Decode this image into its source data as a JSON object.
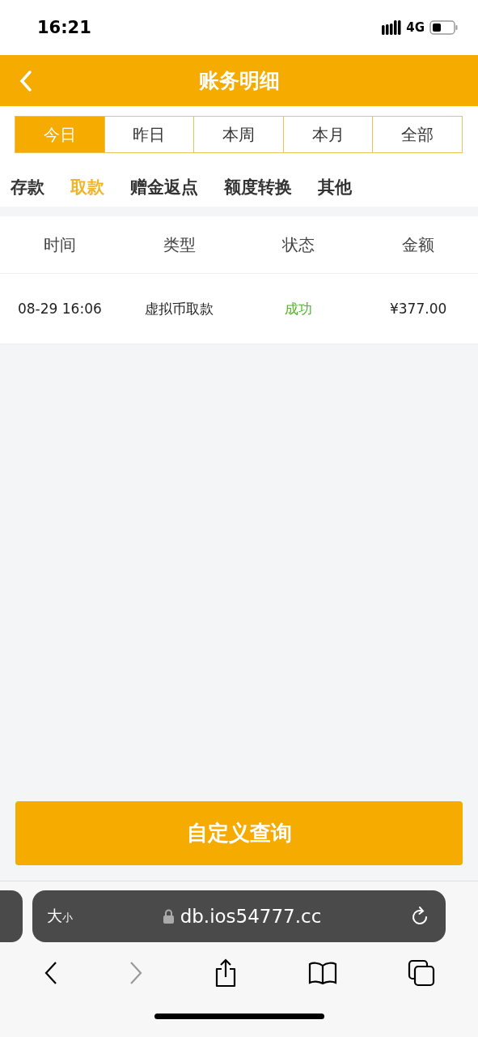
{
  "status_bar": {
    "time": "16:21",
    "network": "4G"
  },
  "header": {
    "title": "账务明细"
  },
  "period_tabs": [
    {
      "label": "今日",
      "selected": true
    },
    {
      "label": "昨日",
      "selected": false
    },
    {
      "label": "本周",
      "selected": false
    },
    {
      "label": "本月",
      "selected": false
    },
    {
      "label": "全部",
      "selected": false
    }
  ],
  "category_tabs": [
    {
      "label": "存款",
      "selected": false
    },
    {
      "label": "取款",
      "selected": true
    },
    {
      "label": "赠金返点",
      "selected": false
    },
    {
      "label": "额度转换",
      "selected": false
    },
    {
      "label": "其他",
      "selected": false
    }
  ],
  "table": {
    "columns": [
      "时间",
      "类型",
      "状态",
      "金额"
    ],
    "rows": [
      {
        "cells": [
          "08-29 16:06",
          "虚拟币取款",
          "成功",
          "¥377.00"
        ],
        "color": "#52b52a"
      }
    ]
  },
  "query_button": "自定义查询",
  "browser": {
    "text_size": "大$_{小}$",
    "url": "db.ios54777.cc",
    "forward_disabled": true
  }
}
